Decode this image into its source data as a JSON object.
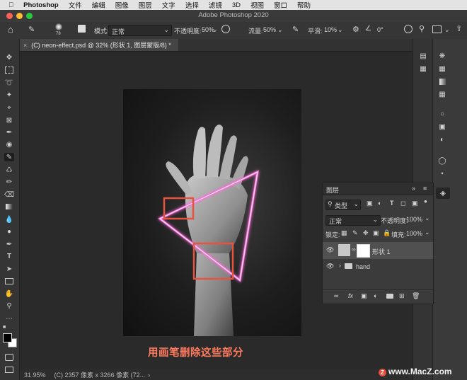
{
  "menubar": {
    "app": "Photoshop",
    "items": [
      "文件",
      "编辑",
      "图像",
      "图层",
      "文字",
      "选择",
      "滤镜",
      "3D",
      "视图",
      "窗口",
      "帮助"
    ]
  },
  "window_title": "Adobe Photoshop 2020",
  "options": {
    "brush_size": "78",
    "mode_label": "模式:",
    "mode_value": "正常",
    "opacity_label": "不透明度:",
    "opacity_value": "50%",
    "flow_label": "流量:",
    "flow_value": "50%",
    "smoothing_label": "平滑:",
    "smoothing_value": "10%",
    "angle_value": "0°"
  },
  "document_tab": "(C) neon-effect.psd @ 32% (形状 1, 图层蒙版/8) *",
  "status": {
    "zoom": "31.95%",
    "info": "(C) 2357 像素 x 3266 像素 (72..."
  },
  "layers_panel": {
    "title": "图层",
    "filter_label": "类型",
    "blend_mode": "正常",
    "opacity_label": "不透明度:",
    "opacity_value": "100%",
    "lock_label": "锁定:",
    "fill_label": "填充:",
    "fill_value": "100%",
    "layers": [
      {
        "name": "形状 1",
        "selected": true
      },
      {
        "name": "hand",
        "selected": false
      }
    ],
    "footer_fx": "fx"
  },
  "caption": "用画笔删除这些部分",
  "watermark": "www.MacZ.com",
  "colors": {
    "highlight_box": "#e8533f",
    "neon_line": "#ff6ad8",
    "caption": "#ff7a5e"
  }
}
